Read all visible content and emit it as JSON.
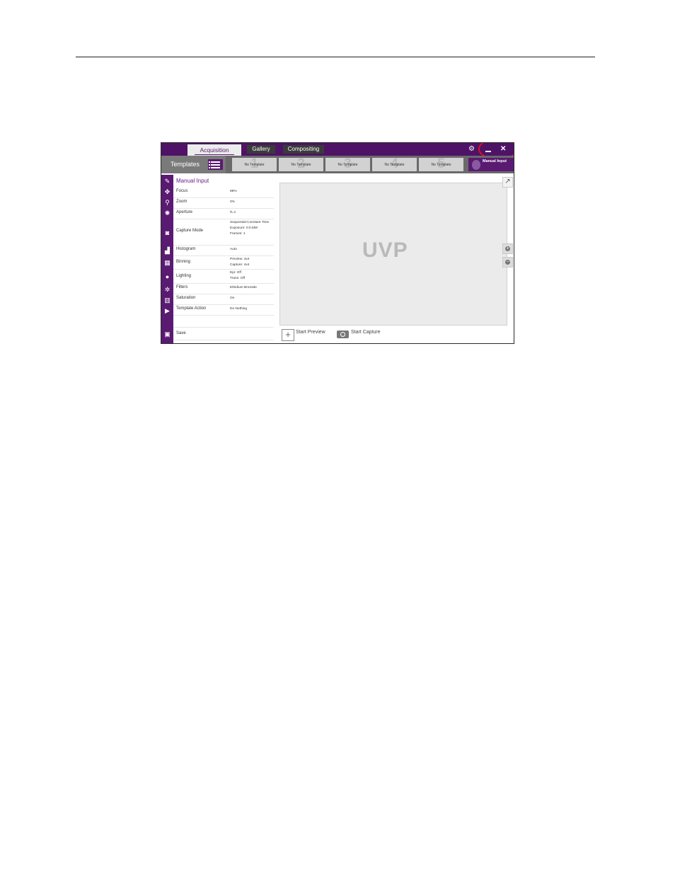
{
  "window": {
    "tabs": {
      "acquisition": "Acquisition",
      "gallery": "Gallery",
      "compositing": "Compositing"
    },
    "controls": {
      "gear": "⚙",
      "close": "✕"
    }
  },
  "templates": {
    "title": "Templates",
    "slots": [
      {
        "number": "1",
        "label": "No Template"
      },
      {
        "number": "2",
        "label": "No Template"
      },
      {
        "number": "3",
        "label": "No Template"
      },
      {
        "number": "4",
        "label": "No Template"
      },
      {
        "number": "5",
        "label": "No Template"
      }
    ],
    "manual": "Manual Input"
  },
  "settings": {
    "header": "Manual Input",
    "rows": [
      {
        "key": "Focus",
        "value": "88%"
      },
      {
        "key": "Zoom",
        "value": "0%"
      },
      {
        "key": "Aperture",
        "value": "f1.2"
      },
      {
        "key": "Capture Mode",
        "value": "Sequential-Constant Time\nExposure: 0:0.559\nFrames: 1"
      },
      {
        "key": "Histogram",
        "value": "Auto"
      },
      {
        "key": "Binning",
        "value": "Preview: 4x4\nCapture: 4x4"
      },
      {
        "key": "Lighting",
        "value": "Epi: Off\nTrans: Off"
      },
      {
        "key": "Filters",
        "value": "Ethidium Bromide"
      },
      {
        "key": "Saturation",
        "value": "On"
      },
      {
        "key": "Template Action",
        "value": "Do Nothing"
      }
    ],
    "save": "Save"
  },
  "preview": {
    "logo": "UVP",
    "start_preview": "Start Preview",
    "start_capture": "Start Capture"
  },
  "icons": [
    "pencil-icon",
    "focus-icon",
    "zoom-icon",
    "aperture-icon",
    "camera-icon",
    "histogram-icon",
    "binning-icon",
    "lighting-icon",
    "filters-icon",
    "saturation-icon",
    "template-action-icon",
    "save-icon"
  ],
  "colors": {
    "brand_purple": "#5a1a72",
    "title_bar": "#4e1366",
    "highlight": "#e0101c"
  }
}
